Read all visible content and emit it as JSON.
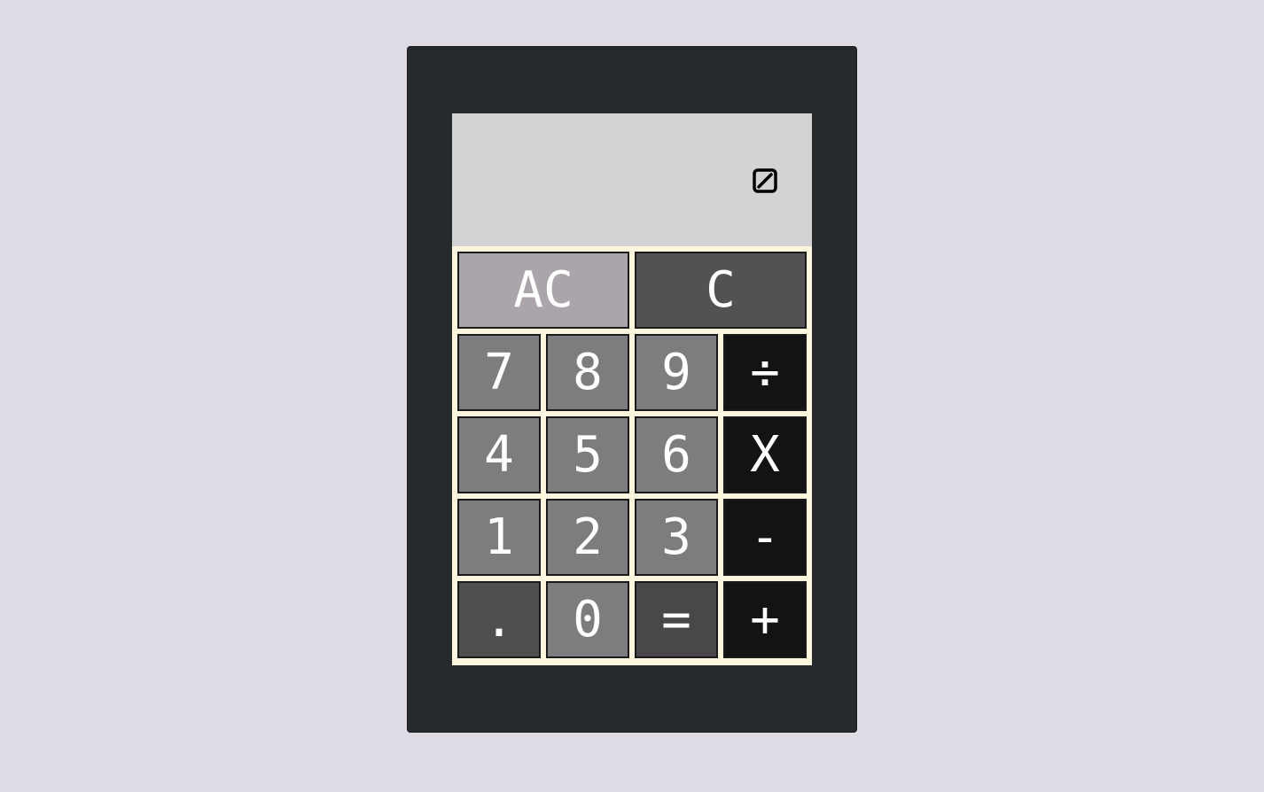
{
  "calculator": {
    "display": {
      "value": "",
      "placeholder_icon": "empty-set-icon"
    },
    "keys": {
      "ac": "AC",
      "c": "C",
      "seven": "7",
      "eight": "8",
      "nine": "9",
      "divide": "÷",
      "four": "4",
      "five": "5",
      "six": "6",
      "multiply": "X",
      "one": "1",
      "two": "2",
      "three": "3",
      "subtract": "-",
      "dot": ".",
      "zero": "0",
      "equals": "=",
      "add": "+"
    },
    "colors": {
      "background": "#dedbe4",
      "body": "#262a2c",
      "display": "#d3d3d3",
      "keypad": "#fdf6df",
      "digit_key": "#7d7d7f",
      "operator_key": "#131313",
      "ac_key": "#aba5ab",
      "c_key": "#545154",
      "dot_key": "#4f4f4f",
      "equals_key": "#4a474a"
    }
  }
}
